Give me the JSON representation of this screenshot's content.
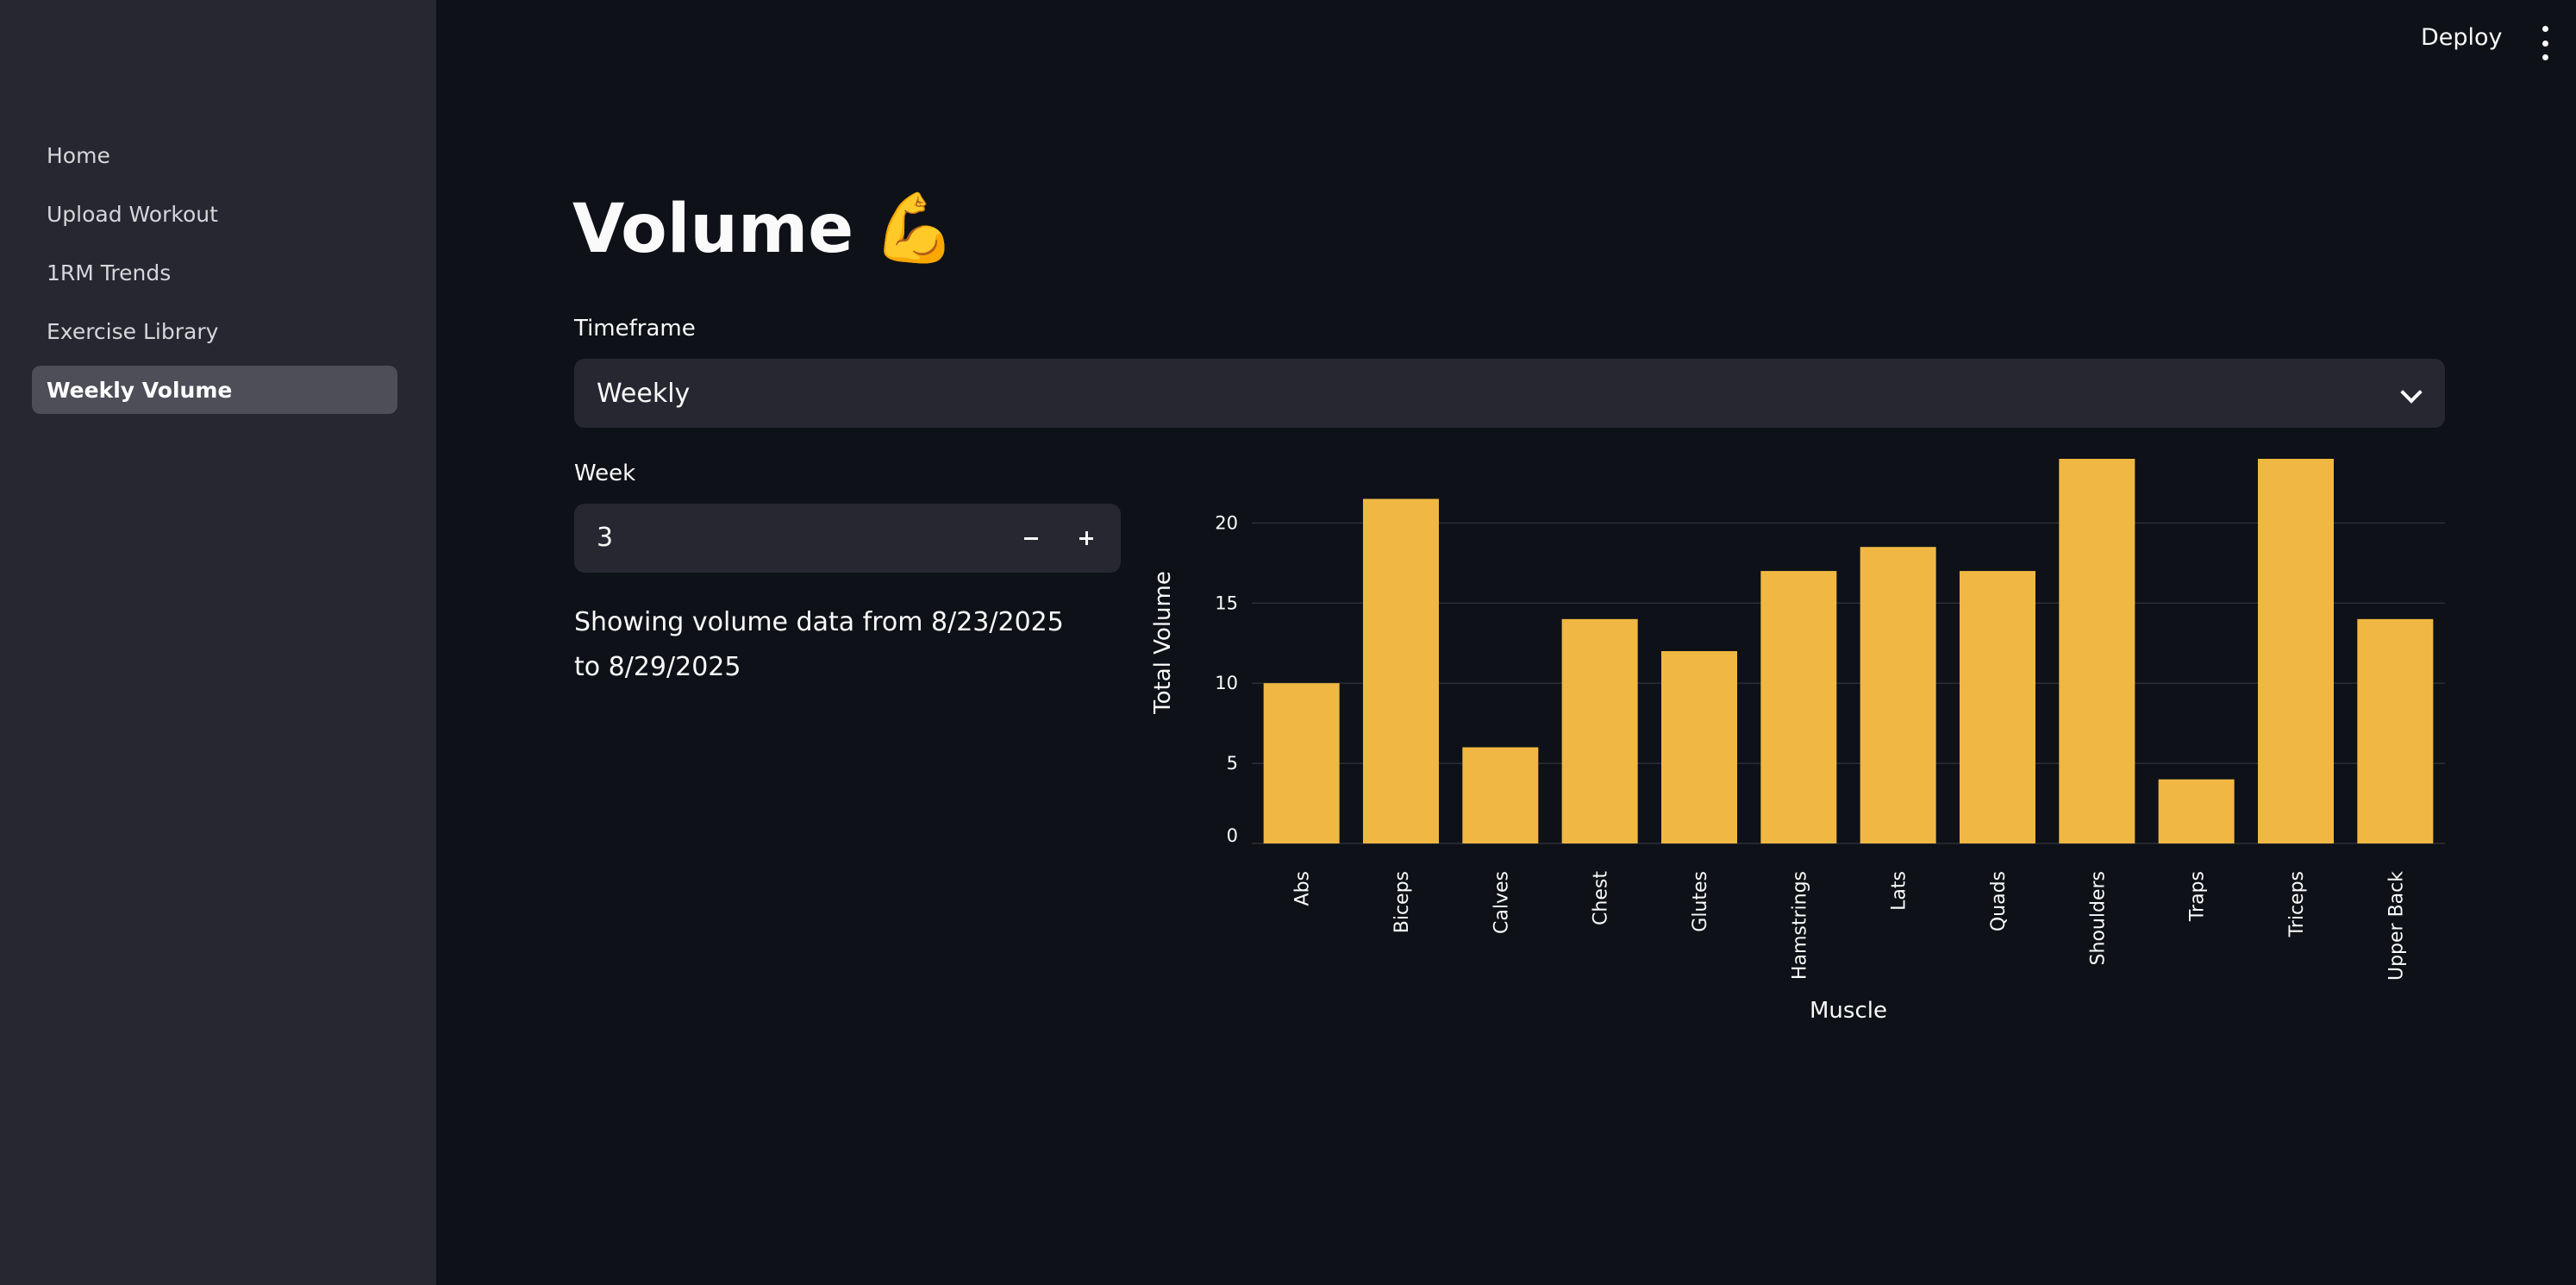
{
  "sidebar": {
    "items": [
      {
        "label": "Home",
        "active": false
      },
      {
        "label": "Upload Workout",
        "active": false
      },
      {
        "label": "1RM Trends",
        "active": false
      },
      {
        "label": "Exercise Library",
        "active": false
      },
      {
        "label": "Weekly Volume",
        "active": true
      }
    ]
  },
  "header": {
    "deploy_label": "Deploy",
    "menu_icon": "more-vertical-icon"
  },
  "main": {
    "title": "Volume",
    "title_emoji": "💪",
    "timeframe": {
      "label": "Timeframe",
      "value": "Weekly"
    },
    "week": {
      "label": "Week",
      "value": "3"
    },
    "date_range_text": "Showing volume data from 8/23/2025 to 8/29/2025"
  },
  "colors": {
    "bar": "#f0b843",
    "background": "#0e1117",
    "sidebar": "#262730",
    "input": "#262730",
    "active_nav": "#4d4e57"
  },
  "chart_data": {
    "type": "bar",
    "categories": [
      "Abs",
      "Biceps",
      "Calves",
      "Chest",
      "Glutes",
      "Hamstrings",
      "Lats",
      "Quads",
      "Shoulders",
      "Traps",
      "Triceps",
      "Upper Back"
    ],
    "values": [
      10,
      21.5,
      6,
      14,
      12,
      17,
      18.5,
      17,
      24,
      4,
      24,
      14
    ],
    "xlabel": "Muscle",
    "ylabel": "Total Volume",
    "yticks": [
      0,
      5,
      10,
      15,
      20
    ],
    "ylim": [
      0,
      24
    ],
    "grid": "horizontal"
  }
}
